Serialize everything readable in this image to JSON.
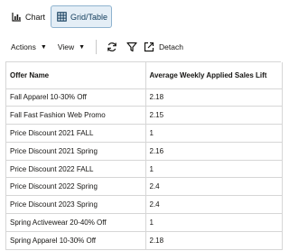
{
  "view_toggle": {
    "chart_label": "Chart",
    "grid_label": "Grid/Table"
  },
  "toolbar": {
    "actions_label": "Actions",
    "view_label": "View",
    "caret": "▼",
    "detach_label": "Detach"
  },
  "table": {
    "headers": [
      "Offer Name",
      "Average Weekly Applied Sales Lift"
    ],
    "rows": [
      [
        "Fall Apparel 10-30% Off",
        "2.18"
      ],
      [
        "Fall Fast Fashion Web Promo",
        "2.15"
      ],
      [
        "Price Discount 2021 FALL",
        "1"
      ],
      [
        "Price Discount 2021 Spring",
        "2.16"
      ],
      [
        "Price Discount 2022 FALL",
        "1"
      ],
      [
        "Price Discount 2022 Spring",
        "2.4"
      ],
      [
        "Price Discount 2023 Spring",
        "2.4"
      ],
      [
        "Spring Activewear 20-40% Off",
        "1"
      ],
      [
        "Spring Apparel 10-30% Off",
        "2.18"
      ]
    ]
  },
  "colors": {
    "selected_bg": "#e4eef6",
    "selected_border": "#8fb3cf",
    "grid_line": "#d6d6d6"
  }
}
